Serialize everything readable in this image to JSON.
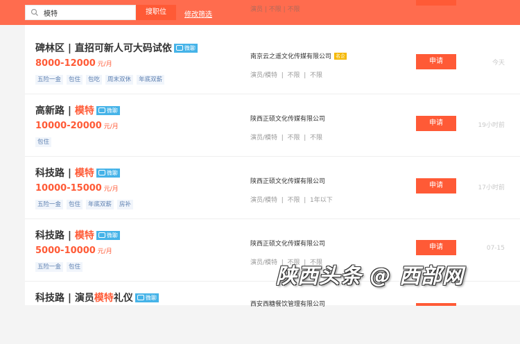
{
  "header": {
    "search_value": "模特",
    "search_button": "搜职位",
    "filter_link": "修改筛选",
    "ghost_text": "演员 | 不限 | 不限"
  },
  "jobs": [
    {
      "location": "碑林区 | ",
      "title_plain": "直招可新人可大码试依",
      "title_highlight": "",
      "title_after": "",
      "wechat_label": "微聊",
      "salary": "8000-12000",
      "salary_unit": " 元/月",
      "tags": [
        "五险一金",
        "包住",
        "包吃",
        "周末双休",
        "年底双薪"
      ],
      "company": "南京云之遥文化传媒有限公司",
      "cert": "名企",
      "requirements": "演员/模特  |  不限  |  不限",
      "apply": "申请",
      "time": "今天"
    },
    {
      "location": "高新路 | ",
      "title_plain": "",
      "title_highlight": "模特",
      "title_after": "",
      "wechat_label": "微聊",
      "salary": "10000-20000",
      "salary_unit": " 元/月",
      "tags": [
        "包住"
      ],
      "company": "陕西正硕文化传媒有限公司",
      "cert": "",
      "requirements": "演员/模特  |  不限  |  不限",
      "apply": "申请",
      "time": "19小时前"
    },
    {
      "location": "科技路 | ",
      "title_plain": "",
      "title_highlight": "模特",
      "title_after": "",
      "wechat_label": "微聊",
      "salary": "10000-15000",
      "salary_unit": " 元/月",
      "tags": [
        "五险一金",
        "包住",
        "年底双薪",
        "房补"
      ],
      "company": "陕西正硕文化传媒有限公司",
      "cert": "",
      "requirements": "演员/模特  |  不限  |  1年以下",
      "apply": "申请",
      "time": "17小时前"
    },
    {
      "location": "科技路 | ",
      "title_plain": "",
      "title_highlight": "模特",
      "title_after": "",
      "wechat_label": "微聊",
      "salary": "5000-10000",
      "salary_unit": " 元/月",
      "tags": [
        "五险一金",
        "包住"
      ],
      "company": "陕西正硕文化传媒有限公司",
      "cert": "",
      "requirements": "演员/模特  |  不限  |  不限",
      "apply": "申请",
      "time": "07-15"
    },
    {
      "location": "科技路 | ",
      "title_plain": "演员",
      "title_highlight": "模特",
      "title_after": "礼仪",
      "wechat_label": "微聊",
      "salary": "",
      "salary_unit": "",
      "tags": [],
      "company": "西安西糖餐饮管理有限公司",
      "cert": "",
      "requirements": "",
      "apply": "",
      "time": ""
    }
  ],
  "watermark": "陕西头条 @ 西部网",
  "colors": {
    "header": "#ff6c4e",
    "accent": "#ff5a36",
    "wechat": "#45b3e8",
    "tag_text": "#5c7fb0"
  }
}
